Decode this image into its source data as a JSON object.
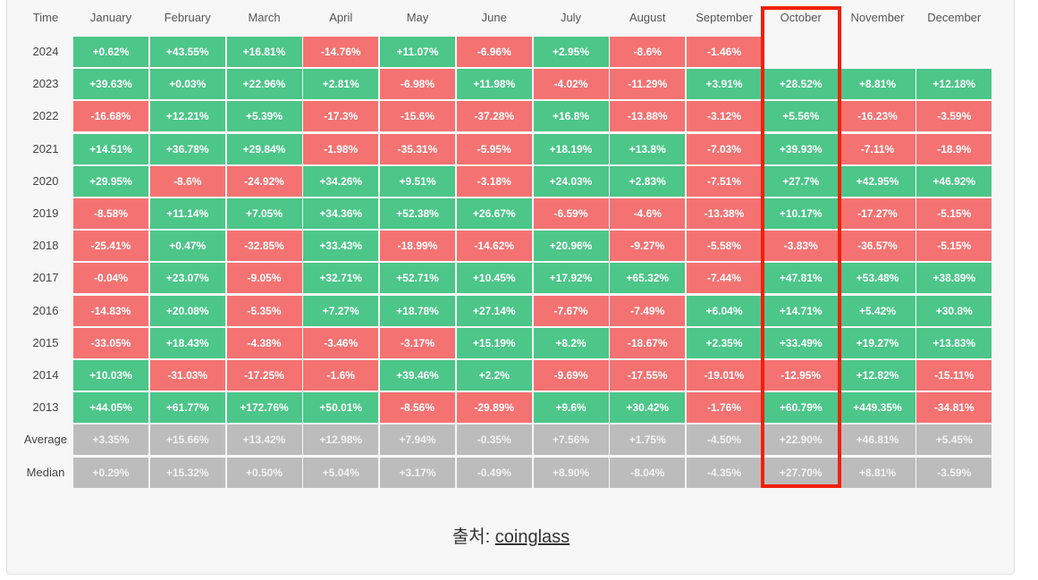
{
  "colors": {
    "positive": "#4cc689",
    "negative": "#f47272",
    "summary": "#bcbcbc",
    "highlight": "#f0200c"
  },
  "chart_data": {
    "type": "table",
    "corner_label": "Time",
    "columns": [
      "January",
      "February",
      "March",
      "April",
      "May",
      "June",
      "July",
      "August",
      "September",
      "October",
      "November",
      "December"
    ],
    "rows": [
      {
        "label": "2024",
        "values": [
          "+0.62%",
          "+43.55%",
          "+16.81%",
          "-14.76%",
          "+11.07%",
          "-6.96%",
          "+2.95%",
          "-8.6%",
          "-1.46%",
          null,
          null,
          null
        ]
      },
      {
        "label": "2023",
        "values": [
          "+39.63%",
          "+0.03%",
          "+22.96%",
          "+2.81%",
          "-6.98%",
          "+11.98%",
          "-4.02%",
          "-11.29%",
          "+3.91%",
          "+28.52%",
          "+8.81%",
          "+12.18%"
        ]
      },
      {
        "label": "2022",
        "values": [
          "-16.68%",
          "+12.21%",
          "+5.39%",
          "-17.3%",
          "-15.6%",
          "-37.28%",
          "+16.8%",
          "-13.88%",
          "-3.12%",
          "+5.56%",
          "-16.23%",
          "-3.59%"
        ]
      },
      {
        "label": "2021",
        "values": [
          "+14.51%",
          "+36.78%",
          "+29.84%",
          "-1.98%",
          "-35.31%",
          "-5.95%",
          "+18.19%",
          "+13.8%",
          "-7.03%",
          "+39.93%",
          "-7.11%",
          "-18.9%"
        ]
      },
      {
        "label": "2020",
        "values": [
          "+29.95%",
          "-8.6%",
          "-24.92%",
          "+34.26%",
          "+9.51%",
          "-3.18%",
          "+24.03%",
          "+2.83%",
          "-7.51%",
          "+27.7%",
          "+42.95%",
          "+46.92%"
        ]
      },
      {
        "label": "2019",
        "values": [
          "-8.58%",
          "+11.14%",
          "+7.05%",
          "+34.36%",
          "+52.38%",
          "+26.67%",
          "-6.59%",
          "-4.6%",
          "-13.38%",
          "+10.17%",
          "-17.27%",
          "-5.15%"
        ]
      },
      {
        "label": "2018",
        "values": [
          "-25.41%",
          "+0.47%",
          "-32.85%",
          "+33.43%",
          "-18.99%",
          "-14.62%",
          "+20.96%",
          "-9.27%",
          "-5.58%",
          "-3.83%",
          "-36.57%",
          "-5.15%"
        ]
      },
      {
        "label": "2017",
        "values": [
          "-0.04%",
          "+23.07%",
          "-9.05%",
          "+32.71%",
          "+52.71%",
          "+10.45%",
          "+17.92%",
          "+65.32%",
          "-7.44%",
          "+47.81%",
          "+53.48%",
          "+38.89%"
        ]
      },
      {
        "label": "2016",
        "values": [
          "-14.83%",
          "+20.08%",
          "-5.35%",
          "+7.27%",
          "+18.78%",
          "+27.14%",
          "-7.67%",
          "-7.49%",
          "+6.04%",
          "+14.71%",
          "+5.42%",
          "+30.8%"
        ]
      },
      {
        "label": "2015",
        "values": [
          "-33.05%",
          "+18.43%",
          "-4.38%",
          "-3.46%",
          "-3.17%",
          "+15.19%",
          "+8.2%",
          "-18.67%",
          "+2.35%",
          "+33.49%",
          "+19.27%",
          "+13.83%"
        ]
      },
      {
        "label": "2014",
        "values": [
          "+10.03%",
          "-31.03%",
          "-17.25%",
          "-1.6%",
          "+39.46%",
          "+2.2%",
          "-9.69%",
          "-17.55%",
          "-19.01%",
          "-12.95%",
          "+12.82%",
          "-15.11%"
        ]
      },
      {
        "label": "2013",
        "values": [
          "+44.05%",
          "+61.77%",
          "+172.76%",
          "+50.01%",
          "-8.56%",
          "-29.89%",
          "+9.6%",
          "+30.42%",
          "-1.76%",
          "+60.79%",
          "+449.35%",
          "-34.81%"
        ]
      },
      {
        "label": "Average",
        "summary": true,
        "values": [
          "+3.35%",
          "+15.66%",
          "+13.42%",
          "+12.98%",
          "+7.94%",
          "-0.35%",
          "+7.56%",
          "+1.75%",
          "-4.50%",
          "+22.90%",
          "+46.81%",
          "+5.45%"
        ]
      },
      {
        "label": "Median",
        "summary": true,
        "values": [
          "+0.29%",
          "+15.32%",
          "+0.50%",
          "+5.04%",
          "+3.17%",
          "-0.49%",
          "+8.90%",
          "-8.04%",
          "-4.35%",
          "+27.70%",
          "+8.81%",
          "-3.59%"
        ]
      }
    ],
    "highlighted_column": "October"
  },
  "caption": {
    "prefix": "출처: ",
    "link": "coinglass"
  }
}
